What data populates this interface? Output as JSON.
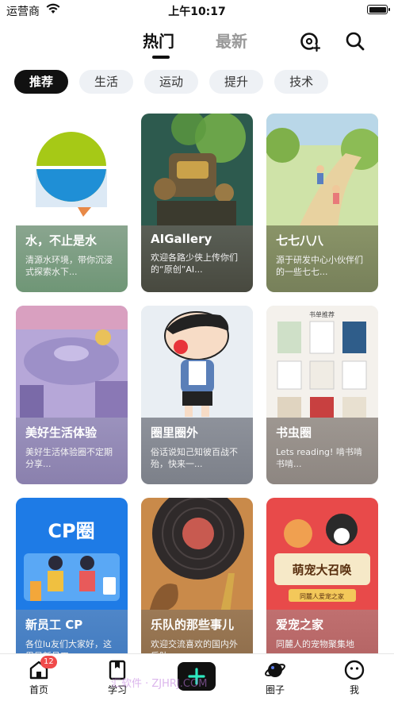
{
  "status_bar": {
    "carrier": "运营商",
    "time": "上午10:17"
  },
  "header": {
    "tabs": [
      {
        "label": "热门"
      },
      {
        "label": "最新"
      }
    ],
    "add_icon": "add-circle-icon",
    "search_icon": "search-icon"
  },
  "categories": [
    {
      "label": "推荐"
    },
    {
      "label": "生活"
    },
    {
      "label": "运动"
    },
    {
      "label": "提升"
    },
    {
      "label": "技术"
    }
  ],
  "cards": [
    {
      "title": "水，不止是水",
      "desc": "清源水环境，带你沉浸式探索水下..."
    },
    {
      "title": "AIGallery",
      "desc": "欢迎各路少侠上传你们的“原创”AI..."
    },
    {
      "title": "七七八八",
      "desc": "源于研发中心小伙伴们的一些七七..."
    },
    {
      "title": "美好生活体验",
      "desc": "美好生活体验圈不定期分享..."
    },
    {
      "title": "圈里圈外",
      "desc": "俗话说知己知彼百战不殆，快来一..."
    },
    {
      "title": "书虫圈",
      "desc": "Lets reading! 啃书啃书啃..."
    },
    {
      "title": "新员工 CP",
      "desc": "各位lu友们大家好，这里是新员工..."
    },
    {
      "title": "乐队的那些事儿",
      "desc": "欢迎交流喜欢的国内外乐队..."
    },
    {
      "title": "爱宠之家",
      "desc": "同麓人的宠物聚集地"
    }
  ],
  "card_art_text": {
    "cp": "CP圈",
    "pet_banner": "萌宠大召唤",
    "pet_sub": "同麓人爱宠之家",
    "book_header": "书单推荐"
  },
  "bottom_nav": [
    {
      "label": "首页",
      "badge": "12"
    },
    {
      "label": "学习"
    },
    {
      "label": ""
    },
    {
      "label": "圈子"
    },
    {
      "label": "我"
    }
  ],
  "watermark": "汇软件 · ZJHRJ.COM"
}
